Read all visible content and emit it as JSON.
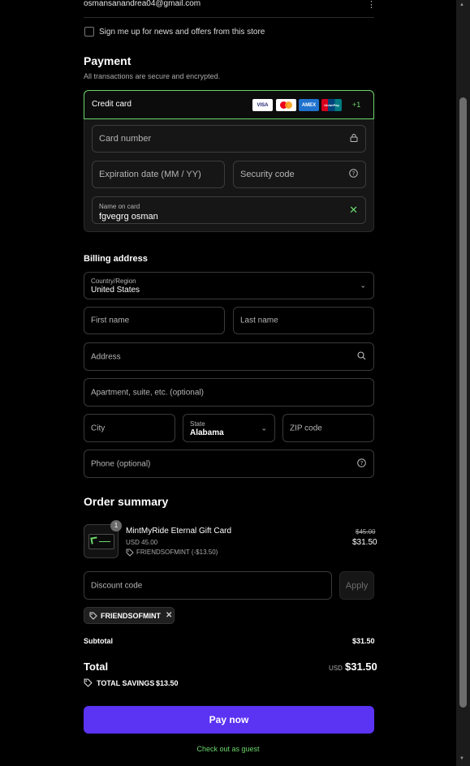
{
  "contact": {
    "email": "osmansanandrea04@gmail.com",
    "menu_icon": "more-vertical-icon"
  },
  "newsletter": {
    "label": "Sign me up for news and offers from this store",
    "checked": false
  },
  "payment": {
    "title": "Payment",
    "subtitle": "All transactions are secure and encrypted.",
    "method_label": "Credit card",
    "brands": [
      "VISA",
      "Mastercard",
      "AMEX",
      "UnionPay"
    ],
    "more_brands": "+1",
    "card_number_placeholder": "Card number",
    "expiry_placeholder": "Expiration date (MM / YY)",
    "security_placeholder": "Security code",
    "name_label": "Name on card",
    "name_value": "fgvegrg osman"
  },
  "billing": {
    "title": "Billing address",
    "country_label": "Country/Region",
    "country_value": "United States",
    "first_name": "First name",
    "last_name": "Last name",
    "address": "Address",
    "apartment": "Apartment, suite, etc. (optional)",
    "city": "City",
    "state_label": "State",
    "state_value": "Alabama",
    "zip": "ZIP code",
    "phone": "Phone (optional)"
  },
  "summary": {
    "title": "Order summary",
    "item": {
      "quantity": "1",
      "name": "MintMyRide Eternal Gift Card",
      "variant": "USD 45.00",
      "discount": "FRIENDSOFMINT (-$13.50)",
      "original_price": "$45.00",
      "price": "$31.50"
    },
    "discount_placeholder": "Discount code",
    "apply_label": "Apply",
    "applied_code": "FRIENDSOFMINT",
    "subtotal_label": "Subtotal",
    "subtotal_value": "$31.50",
    "total_label": "Total",
    "total_currency": "USD",
    "total_value": "$31.50",
    "savings_label": "TOTAL SAVINGS",
    "savings_value": "$13.50"
  },
  "actions": {
    "pay_now": "Pay now",
    "guest": "Check out as guest"
  },
  "colors": {
    "accent": "#5b33f3",
    "success": "#6bd66b",
    "background": "#000000"
  }
}
